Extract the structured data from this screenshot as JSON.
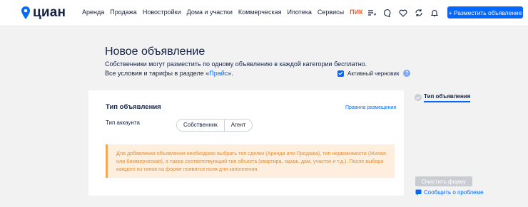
{
  "header": {
    "logo_text": "циан",
    "nav": [
      "Аренда",
      "Продажа",
      "Новостройки",
      "Дома и участки",
      "Коммерческая",
      "Ипотека",
      "Сервисы"
    ],
    "pik_label": "ПИК",
    "post_button": "+ Разместить объявление",
    "icons": [
      "filter-list-icon",
      "chat-icon",
      "heart-icon",
      "compare-icon",
      "bell-icon"
    ]
  },
  "page": {
    "title": "Новое объявление",
    "subtitle": "Собственники могут разместить по одному объявлению в каждой категории бесплатно.",
    "terms_prefix": "Все условия и тарифы в разделе «",
    "terms_link": "Прайс",
    "terms_suffix": "».",
    "draft_label": "Активный черновик",
    "draft_checked": true
  },
  "form": {
    "section_title": "Тип объявления",
    "rules_link": "Правила размещения",
    "account_type_label": "Тип аккаунта",
    "account_options": [
      "Собственник",
      "Агент"
    ],
    "notice": "Для добавления объявления необходимо выбрать тип сделки (Аренда или Продажа), тип недвижимости (Жилая или Коммерческая), а также соответствующий тип объекта (квартира, гараж, дом, участок и т.д.). После выбора каждого из типов на форме появятся поля для заполнения."
  },
  "sidebar": {
    "step_label": "Тип объявления",
    "clear_button": "Очистить форму",
    "report_link": "Сообщить о проблеме"
  },
  "colors": {
    "accent": "#0468ff",
    "notice_bg": "#fdeedd",
    "notice_text": "#e38e36",
    "pik": "#ff5a26"
  }
}
